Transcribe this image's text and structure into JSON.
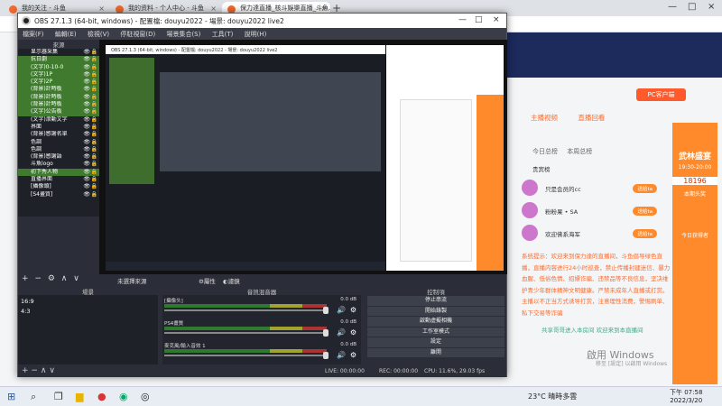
{
  "chrome": {
    "tabs": [
      {
        "label": "我的关注 - 斗鱼"
      },
      {
        "label": "我的资料 - 个人中心 - 斗鱼"
      },
      {
        "label": "保力達直播_核斗娛樂直播_斗魚..."
      }
    ]
  },
  "obs": {
    "title": "OBS 27.1.3 (64-bit, windows) - 配置檔: douyu2022 - 場景: douyu2022 live2",
    "menu": [
      "檔案(F)",
      "編輯(E)",
      "檢視(V)",
      "停駐視窗(D)",
      "場景集合(S)",
      "工具(T)",
      "說明(H)"
    ],
    "sources_header": "來源",
    "sources": [
      {
        "label": "显示器采集",
        "green": false
      },
      {
        "label": "抗日劇",
        "green": true
      },
      {
        "label": "(文字)0-10-0",
        "green": true
      },
      {
        "label": "(文字)1P",
        "green": true
      },
      {
        "label": "(文字)2P",
        "green": true
      },
      {
        "label": "(背景)計時板",
        "green": true
      },
      {
        "label": "(背景)計時板",
        "green": true
      },
      {
        "label": "(背景)計時板",
        "green": true
      },
      {
        "label": "(文字)公告板",
        "green": true
      },
      {
        "label": "(文字)滾動文字",
        "green": false
      },
      {
        "label": "界面",
        "green": false
      },
      {
        "label": "(背景)感謝名單",
        "green": false
      },
      {
        "label": "色調",
        "green": false
      },
      {
        "label": "色調",
        "green": false
      },
      {
        "label": "(背景)感謝語",
        "green": false
      },
      {
        "label": "斗魚logo",
        "green": false
      },
      {
        "label": "初下秀人物",
        "green": true
      },
      {
        "label": "直播界面",
        "green": false
      },
      {
        "label": "[攝像頭]",
        "green": false
      },
      {
        "label": "[S4畫質]",
        "green": false
      }
    ],
    "scene_selected": "未選擇來源",
    "props_label": "屬性",
    "filters_label": "濾鏡",
    "panels": {
      "scenes_header": "場景",
      "mixer_header": "音訊混音器",
      "controls_header": "控制項"
    },
    "scenes": [
      "16:9",
      "4:3"
    ],
    "mixer": [
      {
        "name": "[攝像头]",
        "db": "0.0 dB"
      },
      {
        "name": "PS4畫質",
        "db": "0.0 dB"
      },
      {
        "name": "麥克風/輸入音效 1",
        "db": "0.0 dB"
      }
    ],
    "controls": [
      "停止串流",
      "開始錄製",
      "啟動虛擬相機",
      "工作室模式",
      "設定",
      "離開"
    ],
    "status": {
      "live": "LIVE: 00:00:00",
      "rec": "REC: 00:00:00",
      "cpu": "CPU: 11.6%, 29.03 fps"
    }
  },
  "site": {
    "tabs": [
      "主播视频",
      "直播回看",
      "今日总榜",
      "本周总榜"
    ],
    "rank_title": "贵宾榜",
    "pc_button": "PC客户端",
    "list": [
      {
        "name": "只是会员的cc",
        "badge": "送给ta"
      },
      {
        "name": "粉粉果 • SA",
        "badge": "送给ta"
      },
      {
        "name": "欢迎佛系海军",
        "badge": "送给ta"
      }
    ],
    "sys_msg": "系统提示：欢迎来到保力達的直播间，斗鱼倡导绿色直播，直播内容进行24小时巡查，禁止传播封建迷信、暴力血腥、低俗色情、招嫖诈骗、违禁品等不良信息，坚决维护青少年群体精神文明健康。严禁未成年人直播或打赏。主播以不正当方式诱导打赏，注意理性消费，警惕刷单、私下交易等诈骗",
    "welcome": "共享哥哥进入本房间 欢迎来到本直播间",
    "banner": [
      "武林盛宴",
      "19:30-20:00",
      "18196",
      "本期头奖",
      "今日获得者"
    ],
    "watermark": "啟用 Windows",
    "watermark2": "移至 [設定] 以啟用 Windows"
  },
  "taskbar": {
    "weather": "23°C 晴時多雲",
    "time": "下午 07:58",
    "date": "2022/3/20"
  }
}
